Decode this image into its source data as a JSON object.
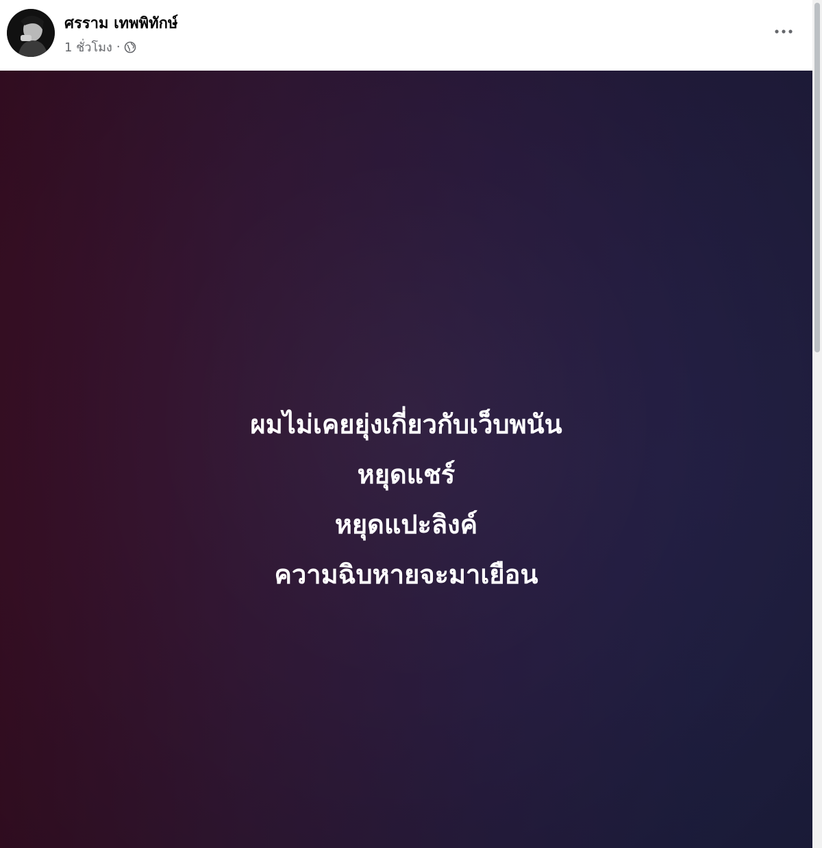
{
  "post": {
    "author_name": "ศรราม เทพพิทักษ์",
    "timestamp": "1 ชั่วโมง",
    "separator": "·",
    "privacy_icon": "globe-icon",
    "avatar_icon": "profile-photo",
    "more_icon": "more-options-icon"
  },
  "image": {
    "lines": [
      "ผมไม่เคยยุ่งเกี่ยวกับเว็บพนัน",
      "หยุดแชร์",
      "หยุดแปะลิงค์",
      "ความฉิบหายจะมาเยือน"
    ],
    "text_color": "#ffffff",
    "background_colors": [
      "#3a0e24",
      "#2c1c3e",
      "#1e2246"
    ]
  },
  "colors": {
    "name": "#050505",
    "meta": "#65676b"
  }
}
